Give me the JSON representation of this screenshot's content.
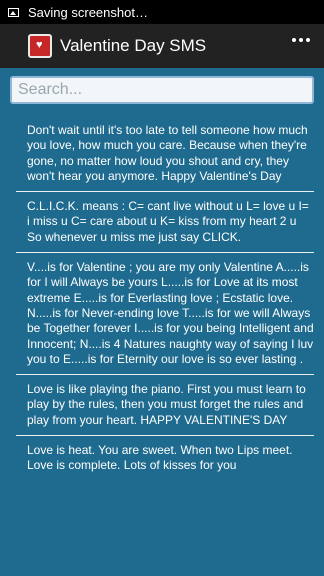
{
  "status_bar": {
    "text": "Saving screenshot…"
  },
  "app_bar": {
    "title": "Valentine Day SMS",
    "logo_icon": "valentine-heart"
  },
  "search": {
    "placeholder": "Search..."
  },
  "messages": [
    {
      "text": "Don't wait until it's too late to tell someone how much you love, how much you care.  Because when they're gone, no matter how loud you shout and cry, they won't hear you anymore. Happy Valentine's Day"
    },
    {
      "text": "C.L.I.C.K. means :  C= cant live without u L= love u I= i miss u C= care about u K= kiss from my heart 2 u So whenever u miss me just say CLICK."
    },
    {
      "text": "V....is for Valentine ; you are my only Valentine A.....is for I will Always be yours L.....is for Love at its most extreme E.....is for Everlasting love ; Ecstatic love. N.....is for Never-ending love T.....is for we will Always be Together forever I.....is for you being Intelligent and Innocent; N....is 4 Natures naughty way of saying I luv you to E.....is for Eternity our love is so ever lasting ."
    },
    {
      "text": "Love is like playing the piano. First you must learn to play by the rules,  then you must forget the rules and play from your heart.  HAPPY VALENTINE'S DAY"
    },
    {
      "text": "Love is heat. You are sweet. When two Lips meet. Love is complete.  Lots of kisses for you"
    }
  ]
}
